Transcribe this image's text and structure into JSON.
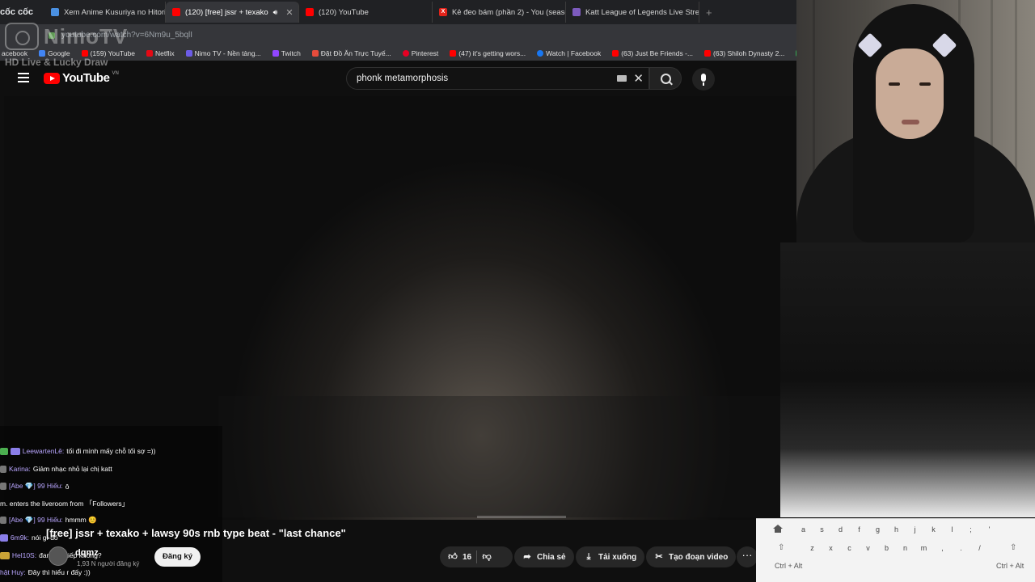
{
  "browser": {
    "logo": "cốc cốc",
    "tabs": [
      {
        "label": "Xem Anime Kusuriya no Hitorigot",
        "active": false
      },
      {
        "label": "(120) [free] jssr + texako",
        "active": true
      },
      {
        "label": "(120) YouTube",
        "active": false
      },
      {
        "label": "Kẻ đeo bám (phần 2) - You (seaso",
        "active": false
      },
      {
        "label": "Katt League of Legends Live Strea",
        "active": false
      }
    ],
    "new_tab": "+",
    "url": "youtube.com/watch?v=6Nm9u_5bqlI",
    "bookmarks": [
      "acebook",
      "Google",
      "(159) YouTube",
      "Netflix",
      "Nimo TV - Nền tảng...",
      "Twitch",
      "Đặt Đồ Ăn Trực Tuyế...",
      "Pinterest",
      "(47) it's getting wors...",
      "Watch | Facebook",
      "(63) Just Be Friends -...",
      "(63) Shiloh Dynasty 2...",
      "highlights"
    ]
  },
  "nimo": {
    "logo": "NimoTV",
    "tagline": "HD Live & Lucky Draw"
  },
  "youtube": {
    "logo": "YouTube",
    "region": "VN",
    "search_query": "phonk metamorphosis"
  },
  "video": {
    "title": "[free] jssr + texako + lawsy 90s rnb type beat - \"last chance\"",
    "channel": "dqmz",
    "subscribers": "1,93 N người đăng ký",
    "subscribe_label": "Đăng ký",
    "likes": "16",
    "share_label": "Chia sẻ",
    "download_label": "Tải xuống",
    "clip_label": "Tạo đoạn video",
    "more_label": "···"
  },
  "chat": [
    {
      "badges": [
        "green",
        "purple"
      ],
      "user": "LeewartenLê:",
      "text": " tối đi mình mấy chỗ tối sợ =))"
    },
    {
      "badges": [],
      "user": "Karina:",
      "text": " Giảm nhạc nhỏ lại chị katt"
    },
    {
      "badges": [],
      "user": "[Abe 💎] 99 Hiếu:",
      "text": " ô"
    },
    {
      "badges": [],
      "user": "",
      "text": "m. enters the liveroom from 「Followers」"
    },
    {
      "badges": [],
      "user": "[Abe 💎] 99 Hiếu:",
      "text": " hmmm 😊"
    },
    {
      "badges": [],
      "user": "6m9k:",
      "text": " nói gì đó"
    },
    {
      "badges": [
        "gold"
      ],
      "user": "Hel10S:",
      "text": " đang trả tiếp không?"
    },
    {
      "badges": [],
      "user": "hật Huy:",
      "text": " Đây thì hiểu r đấy :))"
    }
  ],
  "keyboard": {
    "row1": [
      "a",
      "s",
      "d",
      "f",
      "g",
      "h",
      "j",
      "k",
      "l",
      ";",
      "'"
    ],
    "row2": [
      "z",
      "x",
      "c",
      "v",
      "b",
      "n",
      "m",
      ",",
      ".",
      "/"
    ],
    "ctrl_left": "Ctrl + Alt",
    "ctrl_right": "Ctrl + Alt"
  }
}
